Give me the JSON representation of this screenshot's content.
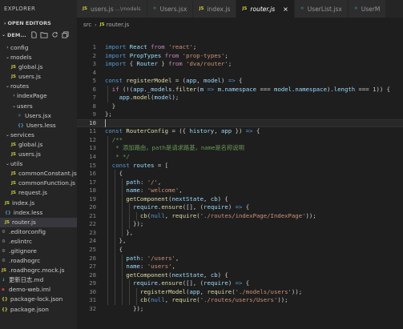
{
  "sidebar": {
    "header": "EXPLORER",
    "open_editors": "OPEN EDITORS",
    "project": "DEM...",
    "actions": [
      "new-file-icon",
      "new-folder-icon",
      "refresh-icon",
      "collapse-all-icon"
    ],
    "tree": [
      {
        "label": "config",
        "depth": 0,
        "type": "folder",
        "open": false
      },
      {
        "label": "models",
        "depth": 0,
        "type": "folder",
        "open": true
      },
      {
        "label": "global.js",
        "depth": 1,
        "type": "js"
      },
      {
        "label": "users.js",
        "depth": 1,
        "type": "js"
      },
      {
        "label": "routes",
        "depth": 0,
        "type": "folder",
        "open": true
      },
      {
        "label": "indexPage",
        "depth": 1,
        "type": "folder",
        "open": false
      },
      {
        "label": "users",
        "depth": 1,
        "type": "folder",
        "open": true
      },
      {
        "label": "Users.jsx",
        "depth": 2,
        "type": "jsx"
      },
      {
        "label": "Users.less",
        "depth": 2,
        "type": "less"
      },
      {
        "label": "services",
        "depth": 0,
        "type": "folder",
        "open": true
      },
      {
        "label": "global.js",
        "depth": 1,
        "type": "js"
      },
      {
        "label": "users.js",
        "depth": 1,
        "type": "js"
      },
      {
        "label": "utils",
        "depth": 0,
        "type": "folder",
        "open": true
      },
      {
        "label": "commonConstant.js",
        "depth": 1,
        "type": "js"
      },
      {
        "label": "commonFunction.js",
        "depth": 1,
        "type": "js"
      },
      {
        "label": "request.js",
        "depth": 1,
        "type": "js"
      },
      {
        "label": "index.js",
        "depth": 0,
        "type": "js"
      },
      {
        "label": "index.less",
        "depth": 0,
        "type": "less"
      },
      {
        "label": "router.js",
        "depth": 0,
        "type": "js",
        "active": true
      },
      {
        "label": ".editorconfig",
        "depth": -1,
        "type": "cfg"
      },
      {
        "label": ".eslintrc",
        "depth": -1,
        "type": "cfg"
      },
      {
        "label": ".gitignore",
        "depth": -1,
        "type": "cfg"
      },
      {
        "label": ".roadhogrc",
        "depth": -1,
        "type": "cfg"
      },
      {
        "label": ".roadhogrc.mock.js",
        "depth": -1,
        "type": "js"
      },
      {
        "label": "更新日志.md",
        "depth": -1,
        "type": "md"
      },
      {
        "label": "demo-web.iml",
        "depth": -1,
        "type": "iml"
      },
      {
        "label": "package-lock.json",
        "depth": -1,
        "type": "json"
      },
      {
        "label": "package.json",
        "depth": -1,
        "type": "json"
      }
    ]
  },
  "tabs": [
    {
      "label": "users.js",
      "desc": "...\\models",
      "type": "js"
    },
    {
      "label": "Users.jsx",
      "desc": "",
      "type": "jsx"
    },
    {
      "label": "index.js",
      "desc": "",
      "type": "js"
    },
    {
      "label": "router.js",
      "desc": "",
      "type": "js",
      "active": true,
      "close": "×"
    },
    {
      "label": "UserList.jsx",
      "desc": "",
      "type": "jsx"
    },
    {
      "label": "UserM",
      "desc": "",
      "type": "jsx"
    }
  ],
  "breadcrumb": {
    "folder": "src",
    "file": "router.js"
  },
  "editor": {
    "active_line": 10,
    "lines": [
      [
        [
          "k",
          "import "
        ],
        [
          "v",
          "React "
        ],
        [
          "kc",
          "from "
        ],
        [
          "s",
          "'react'"
        ],
        [
          "p",
          ";"
        ]
      ],
      [
        [
          "k",
          "import "
        ],
        [
          "v",
          "PropTypes "
        ],
        [
          "kc",
          "from "
        ],
        [
          "s",
          "'prop-types'"
        ],
        [
          "p",
          ";"
        ]
      ],
      [
        [
          "k",
          "import "
        ],
        [
          "p",
          "{ "
        ],
        [
          "v",
          "Router "
        ],
        [
          "p",
          "} "
        ],
        [
          "kc",
          "from "
        ],
        [
          "s",
          "'dva/router'"
        ],
        [
          "p",
          ";"
        ]
      ],
      [],
      [
        [
          "k",
          "const "
        ],
        [
          "fn",
          "registerModel"
        ],
        [
          "p",
          " = ("
        ],
        [
          "v",
          "app"
        ],
        [
          "p",
          ", "
        ],
        [
          "v",
          "model"
        ],
        [
          "p",
          ") "
        ],
        [
          "k",
          "=>"
        ],
        [
          "p",
          " {"
        ]
      ],
      [
        [
          "p",
          "  "
        ],
        [
          "kc",
          "if "
        ],
        [
          "p",
          "(!("
        ],
        [
          "v",
          "app"
        ],
        [
          "p",
          "."
        ],
        [
          "v",
          "_models"
        ],
        [
          "p",
          "."
        ],
        [
          "fn",
          "filter"
        ],
        [
          "p",
          "("
        ],
        [
          "v",
          "m"
        ],
        [
          "p",
          " "
        ],
        [
          "k",
          "=>"
        ],
        [
          "p",
          " "
        ],
        [
          "v",
          "m"
        ],
        [
          "p",
          "."
        ],
        [
          "v",
          "namespace"
        ],
        [
          "p",
          " === "
        ],
        [
          "v",
          "model"
        ],
        [
          "p",
          "."
        ],
        [
          "v",
          "namespace"
        ],
        [
          "p",
          ")."
        ],
        [
          "v",
          "length"
        ],
        [
          "p",
          " === "
        ],
        [
          "n",
          "1"
        ],
        [
          "p",
          ")) {"
        ]
      ],
      [
        [
          "p",
          "    "
        ],
        [
          "v",
          "app"
        ],
        [
          "p",
          "."
        ],
        [
          "fn",
          "model"
        ],
        [
          "p",
          "("
        ],
        [
          "v",
          "model"
        ],
        [
          "p",
          ");"
        ]
      ],
      [
        [
          "p",
          "  }"
        ]
      ],
      [
        [
          "p",
          "};"
        ]
      ],
      [],
      [
        [
          "k",
          "const "
        ],
        [
          "fn",
          "RouterConfig"
        ],
        [
          "p",
          " = ({ "
        ],
        [
          "v",
          "history"
        ],
        [
          "p",
          ", "
        ],
        [
          "v",
          "app"
        ],
        [
          "p",
          " }) "
        ],
        [
          "k",
          "=>"
        ],
        [
          "p",
          " {"
        ]
      ],
      [
        [
          "p",
          "  "
        ],
        [
          "c",
          "/**"
        ]
      ],
      [
        [
          "p",
          "  "
        ],
        [
          "c",
          " * 添加路由，path是请求路基，name是名称说明"
        ]
      ],
      [
        [
          "p",
          "  "
        ],
        [
          "c",
          " * */"
        ]
      ],
      [
        [
          "p",
          "  "
        ],
        [
          "k",
          "const "
        ],
        [
          "v",
          "routes"
        ],
        [
          "p",
          " = ["
        ]
      ],
      [
        [
          "p",
          "    {"
        ]
      ],
      [
        [
          "p",
          "      "
        ],
        [
          "v",
          "path"
        ],
        [
          "p",
          ": "
        ],
        [
          "s",
          "'/'"
        ],
        [
          "p",
          ","
        ]
      ],
      [
        [
          "p",
          "      "
        ],
        [
          "v",
          "name"
        ],
        [
          "p",
          ": "
        ],
        [
          "s",
          "'welcome'"
        ],
        [
          "p",
          ","
        ]
      ],
      [
        [
          "p",
          "      "
        ],
        [
          "fn",
          "getComponent"
        ],
        [
          "p",
          "("
        ],
        [
          "v",
          "nextState"
        ],
        [
          "p",
          ", "
        ],
        [
          "v",
          "cb"
        ],
        [
          "p",
          ") {"
        ]
      ],
      [
        [
          "p",
          "        "
        ],
        [
          "v",
          "require"
        ],
        [
          "p",
          "."
        ],
        [
          "fn",
          "ensure"
        ],
        [
          "p",
          "([], ("
        ],
        [
          "v",
          "require"
        ],
        [
          "p",
          ") "
        ],
        [
          "k",
          "=>"
        ],
        [
          "p",
          " {"
        ]
      ],
      [
        [
          "p",
          "          "
        ],
        [
          "fn",
          "cb"
        ],
        [
          "p",
          "("
        ],
        [
          "k",
          "null"
        ],
        [
          "p",
          ", "
        ],
        [
          "fn",
          "require"
        ],
        [
          "p",
          "("
        ],
        [
          "s",
          "'./routes/indexPage/IndexPage'"
        ],
        [
          "p",
          "));"
        ]
      ],
      [
        [
          "p",
          "        });"
        ]
      ],
      [
        [
          "p",
          "      },"
        ]
      ],
      [
        [
          "p",
          "    },"
        ]
      ],
      [
        [
          "p",
          "    {"
        ]
      ],
      [
        [
          "p",
          "      "
        ],
        [
          "v",
          "path"
        ],
        [
          "p",
          ": "
        ],
        [
          "s",
          "'/users'"
        ],
        [
          "p",
          ","
        ]
      ],
      [
        [
          "p",
          "      "
        ],
        [
          "v",
          "name"
        ],
        [
          "p",
          ": "
        ],
        [
          "s",
          "'users'"
        ],
        [
          "p",
          ","
        ]
      ],
      [
        [
          "p",
          "      "
        ],
        [
          "fn",
          "getComponent"
        ],
        [
          "p",
          "("
        ],
        [
          "v",
          "nextState"
        ],
        [
          "p",
          ", "
        ],
        [
          "v",
          "cb"
        ],
        [
          "p",
          ") {"
        ]
      ],
      [
        [
          "p",
          "        "
        ],
        [
          "v",
          "require"
        ],
        [
          "p",
          "."
        ],
        [
          "fn",
          "ensure"
        ],
        [
          "p",
          "([], ("
        ],
        [
          "v",
          "require"
        ],
        [
          "p",
          ") "
        ],
        [
          "k",
          "=>"
        ],
        [
          "p",
          " {"
        ]
      ],
      [
        [
          "p",
          "          "
        ],
        [
          "fn",
          "registerModel"
        ],
        [
          "p",
          "("
        ],
        [
          "v",
          "app"
        ],
        [
          "p",
          ", "
        ],
        [
          "fn",
          "require"
        ],
        [
          "p",
          "("
        ],
        [
          "s",
          "'./models/users'"
        ],
        [
          "p",
          "));"
        ]
      ],
      [
        [
          "p",
          "          "
        ],
        [
          "fn",
          "cb"
        ],
        [
          "p",
          "("
        ],
        [
          "k",
          "null"
        ],
        [
          "p",
          ", "
        ],
        [
          "fn",
          "require"
        ],
        [
          "p",
          "("
        ],
        [
          "s",
          "'./routes/users/Users'"
        ],
        [
          "p",
          "));"
        ]
      ],
      [
        [
          "p",
          "        });"
        ]
      ]
    ]
  }
}
